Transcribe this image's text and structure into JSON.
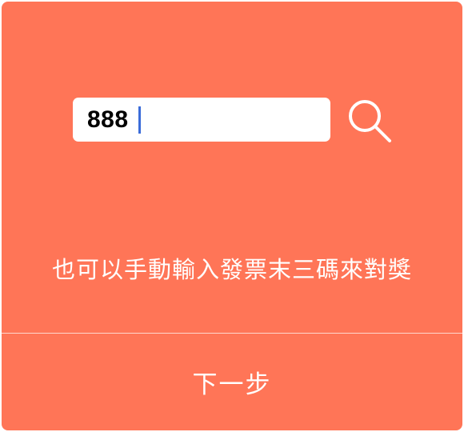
{
  "search": {
    "value": "888",
    "icon": "search-icon"
  },
  "hint": {
    "text": "也可以手動輸入發票末三碼來對獎"
  },
  "footer": {
    "next_label": "下一步"
  },
  "colors": {
    "background": "#FF7557",
    "text": "#FFFFFF",
    "caret": "#3B6CD9"
  }
}
